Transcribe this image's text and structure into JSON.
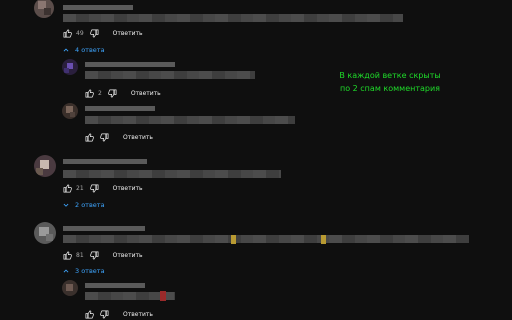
{
  "comments": [
    {
      "likes": "49",
      "reply_label": "Ответить",
      "replies_toggle": "4 ответа"
    },
    {
      "likes": "2",
      "reply_label": "Ответить"
    },
    {
      "likes": "",
      "reply_label": "Ответить"
    },
    {
      "likes": "21",
      "reply_label": "Ответить",
      "replies_toggle": "2 ответа"
    },
    {
      "likes": "81",
      "reply_label": "Ответить",
      "replies_toggle": "3 ответа"
    },
    {
      "likes": "",
      "reply_label": "Ответить"
    }
  ],
  "annotation": {
    "line1": "В каждой ветке скрыты",
    "line2": "по 2 спам комментария",
    "color": "#1fdc2a"
  },
  "colors": {
    "background": "#0f0f0f",
    "link": "#3ea6ff",
    "text": "#f1f1f1",
    "muted": "#aaaaaa"
  },
  "icons": {
    "like": "thumbs-up-icon",
    "dislike": "thumbs-down-icon",
    "toggle": "chevron-up-icon"
  }
}
